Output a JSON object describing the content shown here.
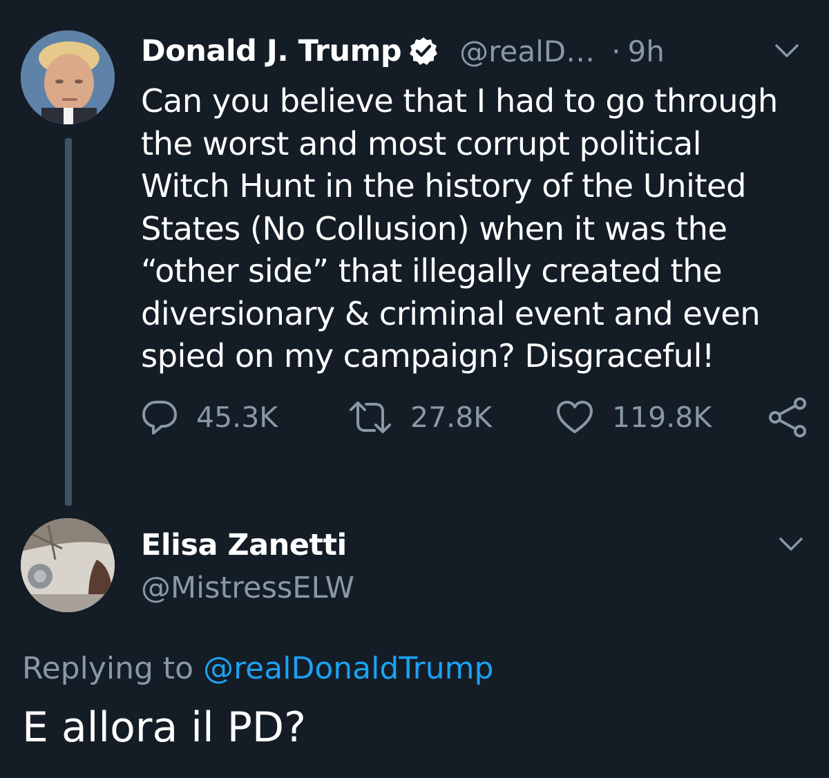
{
  "colors": {
    "background": "#141d26",
    "primary_text": "#ffffff",
    "secondary_text": "#8899a6",
    "link": "#1da1f2",
    "thread_line": "#3d5466"
  },
  "original_tweet": {
    "avatar_icon": "profile-photo",
    "display_name": "Donald J. Trump",
    "verified_icon": "verified-badge-icon",
    "handle": "@realD…",
    "separator": "·",
    "time": "9h",
    "menu_icon": "chevron-down-icon",
    "text": "Can you believe that I had to go through\nthe worst and most corrupt political\nWitch Hunt in the history of the United\nStates (No Collusion) when it was the\n“other side” that illegally created the\ndiversionary & criminal event and even\nspied on my campaign? Disgraceful!",
    "actions": {
      "reply_count": "45.3K",
      "retweet_count": "27.8K",
      "like_count": "119.8K"
    }
  },
  "reply_tweet": {
    "avatar_icon": "profile-photo",
    "display_name": "Elisa Zanetti",
    "handle": "@MistressELW",
    "menu_icon": "chevron-down-icon",
    "replying_prefix": "Replying to",
    "replying_to": "@realDonaldTrump",
    "text": "E allora il PD?"
  }
}
